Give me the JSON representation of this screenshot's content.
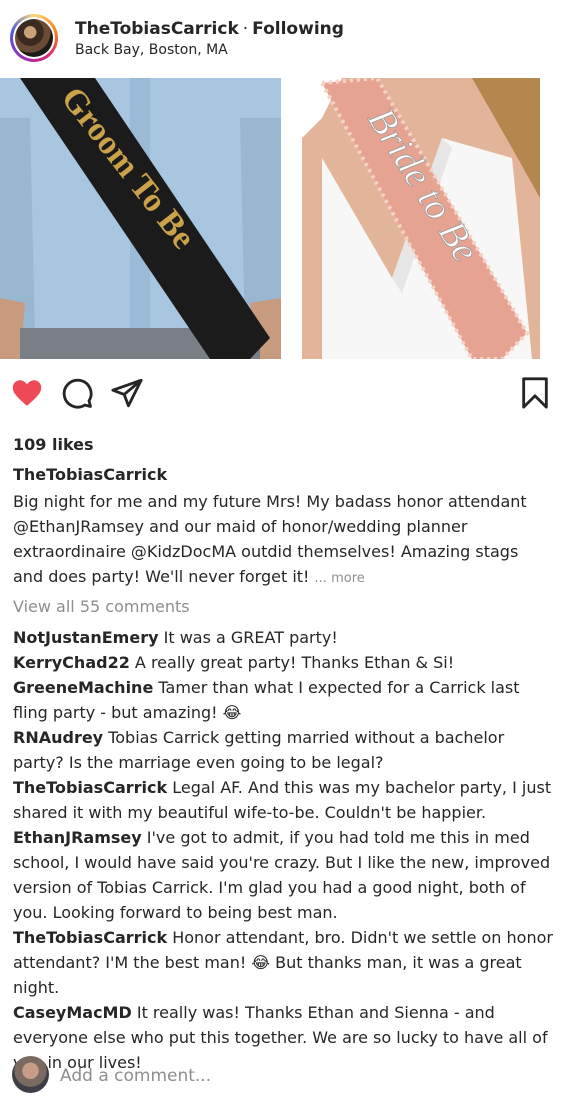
{
  "post": {
    "username": "TheTobiasCarrick",
    "separator": "·",
    "follow_status": "Following",
    "location": "Back Bay, Boston, MA"
  },
  "images": {
    "left_sash_text": "Groom To Be",
    "right_sash_text": "Bride to Be"
  },
  "actions": {
    "like_icon": "heart-filled-icon",
    "comment_icon": "comment-icon",
    "share_icon": "paper-plane-icon",
    "save_icon": "bookmark-icon",
    "like_color": "#ed4956"
  },
  "likes": "109 likes",
  "caption": {
    "username": "TheTobiasCarrick",
    "text": "Big night for me and my future Mrs! My badass honor attendant @EthanJRamsey and our maid of honor/wedding planner extraordinaire @KidzDocMA outdid themselves! Amazing stags and does party! We'll never forget it!",
    "more": "... more"
  },
  "view_all": "View all 55 comments",
  "comments": [
    {
      "user": "NotJustanEmery",
      "text": "It was a GREAT party!"
    },
    {
      "user": "KerryChad22",
      "text": "A really great party! Thanks Ethan & Si!"
    },
    {
      "user": "GreeneMachine",
      "text": "Tamer than what I expected for a Carrick last fling party - but amazing! 😂"
    },
    {
      "user": "RNAudrey",
      "text": "Tobias Carrick getting married without a bachelor party? Is the marriage even going to be legal?"
    },
    {
      "user": "TheTobiasCarrick",
      "text": "Legal AF. And this was my bachelor party, I just shared it with my beautiful wife-to-be. Couldn't be happier."
    },
    {
      "user": "EthanJRamsey",
      "text": "I've got to admit, if you had told me this in med school, I would have said you're crazy. But I like the new, improved version of Tobias Carrick. I'm glad you had a good night, both of you. Looking forward to being best man."
    },
    {
      "user": "TheTobiasCarrick",
      "text": "Honor attendant, bro. Didn't we settle on honor attendant? I'M the best man! 😂 But thanks man, it was a great night."
    },
    {
      "user": "CaseyMacMD",
      "text": "It really was! Thanks Ethan and Sienna - and everyone else who put this together. We are so lucky to have all of you in our lives!"
    }
  ],
  "add_comment_placeholder": "Add a comment..."
}
